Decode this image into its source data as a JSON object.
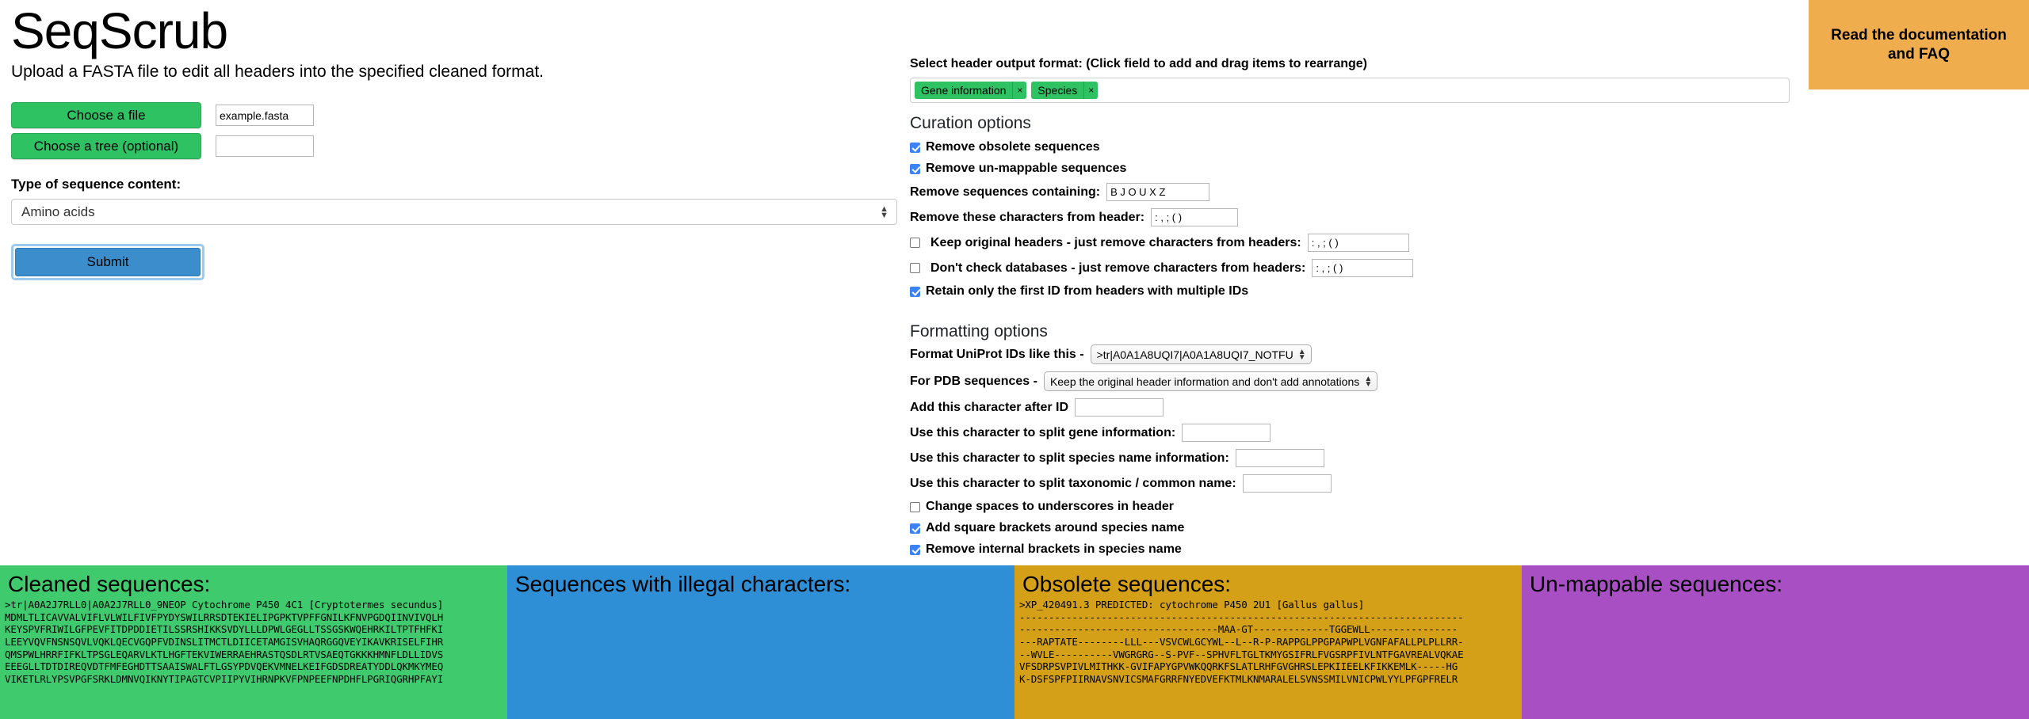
{
  "app": {
    "title": "SeqScrub",
    "subtitle": "Upload a FASTA file to edit all headers into the specified cleaned format."
  },
  "doc_banner": {
    "label": "Read the documentation and FAQ",
    "color": "#f0ad4e"
  },
  "upload": {
    "choose_file_label": "Choose a file",
    "file_name": "example.fasta",
    "choose_tree_label": "Choose a tree (optional)",
    "tree_name": "",
    "sequence_type_label": "Type of sequence content:",
    "sequence_type_value": "Amino acids",
    "submit_label": "Submit"
  },
  "header_format": {
    "label": "Select header output format: (Click field to add and drag items to rearrange)",
    "tags": [
      {
        "label": "Gene information",
        "remove": "×"
      },
      {
        "label": "Species",
        "remove": "×"
      }
    ]
  },
  "curation": {
    "heading": "Curation options",
    "remove_obsolete": {
      "label": "Remove obsolete sequences",
      "checked": true
    },
    "remove_unmappable": {
      "label": "Remove un-mappable sequences",
      "checked": true
    },
    "remove_sequences_containing": {
      "label": "Remove sequences containing:",
      "value": "B J O U X Z"
    },
    "remove_chars_from_header": {
      "label": "Remove these characters from header:",
      "value": ": , ; ( )"
    },
    "keep_original_headers": {
      "label": "Keep original headers - just remove characters from headers:",
      "value": ": , ; ( )",
      "checked": false
    },
    "dont_check_databases": {
      "label": "Don't check databases - just remove characters from headers:",
      "value": ": , ; ( )",
      "checked": false
    },
    "retain_first_id": {
      "label": "Retain only the first ID from headers with multiple IDs",
      "checked": true
    }
  },
  "formatting": {
    "heading": "Formatting options",
    "uniprot_label": "Format UniProt IDs like this -",
    "uniprot_value": ">tr|A0A1A8UQI7|A0A1A8UQI7_NOTFU",
    "pdb_label": "For PDB sequences -",
    "pdb_value": "Keep the original header information and don't add annotations",
    "add_char_after_id": {
      "label": "Add this character after ID",
      "value": ""
    },
    "split_gene": {
      "label": "Use this character to split gene information:",
      "value": ""
    },
    "split_species": {
      "label": "Use this character to split species name information:",
      "value": ""
    },
    "split_taxonomic": {
      "label": "Use this character to split taxonomic / common name:",
      "value": ""
    },
    "spaces_to_underscores": {
      "label": "Change spaces to underscores in header",
      "checked": false
    },
    "add_square_brackets": {
      "label": "Add square brackets around species name",
      "checked": true
    },
    "remove_internal_brackets": {
      "label": "Remove internal brackets in species name",
      "checked": true
    }
  },
  "panels": {
    "cleaned": {
      "title": "Cleaned sequences:",
      "color": "#3fcb6d",
      "text": ">tr|A0A2J7RLL0|A0A2J7RLL0_9NEOP Cytochrome P450 4C1 [Cryptotermes secundus]\nMDMLTLICAVVALVIFLVLWILFIVFPYDYSWILRRSDTEKIELIPGPKTVPFFGNILKFNVPGDQIINVIVQLH\nKEYSPVFRIWILGFPEVFITDPDDIETILSSRSHIKKSVDYLLLDPWLGEGLLTSSGSKWQEHRKILTPTFHFKI\nLEEYVQVFNSNSQVLVQKLQECVGQPFVDINSLITMCTLDIICETAMGISVHAQRGGQVEYIKAVKRISELFIHR\nQMSPWLHRRFIFKLTPSGLEQARVLKTLHGFTEKVIWERRAEHRASTQSDLRTVSAEQTGKKKHMNFLDLLIDVS\nEEEGLLTDTDIREQVDTFMFEGHDTTSAAISWALFTLGSYPDVQEKVMNELKEIFGDSDREATYDDLQKMKYMEQ\nVIKETLRLYPSVPGFSRKLDMNVQIKNYTIPAGTCVPIIPYVIHRNPKVFPNPEEFNPDHFLPGRIQGRHPFAYI"
    },
    "illegal": {
      "title": "Sequences with illegal characters:",
      "color": "#2e8ed6",
      "text": ""
    },
    "obsolete": {
      "title": "Obsolete sequences:",
      "color": "#d4a017",
      "text": ">XP_420491.3 PREDICTED: cytochrome P450 2U1 [Gallus gallus]\n----------------------------------------------------------------------------\n----------------------------------MAA-GT-------------TGGEWLL---------------\n---RAPTATE--------LLL---VSVCWLGCYWL--L--R-P-RAPPGLPPGPAPWPLVGNFAFALLPLPLLRR-\n--WVLE----------VWGRGRG--S-PVF--SPHVFLTGLTKMYGSIFRLFVGSRPFIVLNTFGAVREALVQKAE\nVFSDRPSVPIVLMITHKK-GVIFAPYGPVWKQQRKFSLATLRHFGVGHRSLEPKIIEELKFIKKEMLK-----HG\nK-DSFSPFPIIRNAVSNVICSMAFGRRFNYEDVEFKTMLKNMARALELSVNSSMILVNICPWLYYLPFGPFRELR"
    },
    "unmappable": {
      "title": "Un-mappable sequences:",
      "color": "#a84fc4",
      "text": ""
    }
  }
}
